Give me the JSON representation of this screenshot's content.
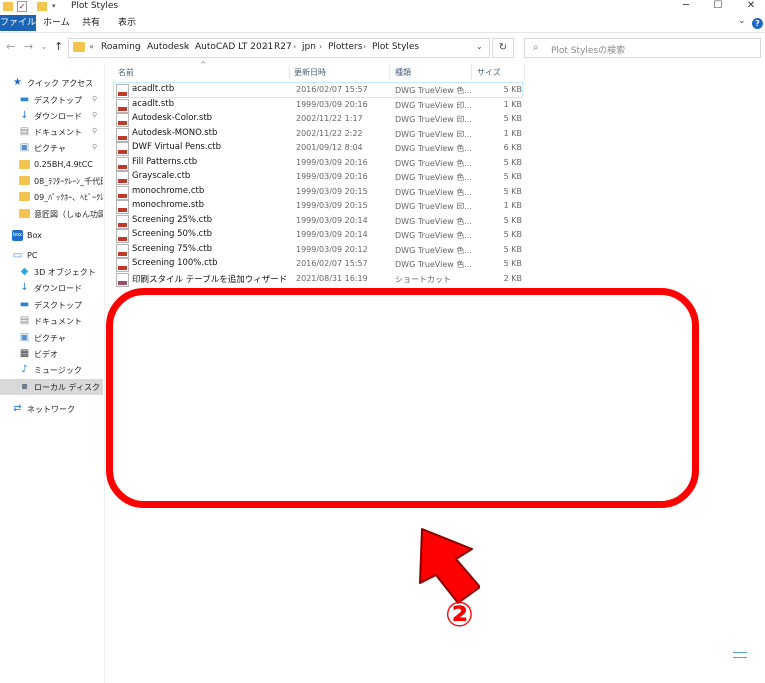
{
  "window": {
    "title": "Plot Styles",
    "minimize": "─",
    "maximize": "☐",
    "close": "✕"
  },
  "ribbon": {
    "tabs": [
      "ファイル",
      "ホーム",
      "共有",
      "表示"
    ],
    "expand": "⌄",
    "help": "?"
  },
  "nav": {
    "back": "←",
    "forward": "→",
    "recent": "⌄",
    "up": "↑",
    "overflow": "«",
    "breadcrumbs": [
      "Roaming",
      "Autodesk",
      "AutoCAD LT 2021",
      "R27",
      "jpn",
      "Plotters",
      "Plot Styles"
    ],
    "dropdown": "⌄",
    "refresh": "↻",
    "search_placeholder": "Plot Stylesの検索"
  },
  "sidebar": {
    "items": [
      {
        "label": "クイック アクセス",
        "icon": "star-icon",
        "pinned": false
      },
      {
        "label": "デスクトップ",
        "icon": "desktop-icon",
        "pinned": true
      },
      {
        "label": "ダウンロード",
        "icon": "download-icon",
        "pinned": true
      },
      {
        "label": "ドキュメント",
        "icon": "documents-icon",
        "pinned": true
      },
      {
        "label": "ピクチャ",
        "icon": "pictures-icon",
        "pinned": true
      },
      {
        "label": "0.25BH,4.9tCC",
        "icon": "folder-icon",
        "pinned": false
      },
      {
        "label": "08_ﾗﾌﾀｰｸﾚｰﾝ_千代田",
        "icon": "folder-icon",
        "pinned": false
      },
      {
        "label": "09_ﾊﾞｯｸﾎｰ、ﾍﾋﾞｰｸﾚｲﾄ",
        "icon": "folder-icon",
        "pinned": false
      },
      {
        "label": "意匠図（しゅん功図ﾅ",
        "icon": "folder-icon",
        "pinned": false
      },
      {
        "label": "Box",
        "icon": "box-icon",
        "pinned": false
      },
      {
        "label": "PC",
        "icon": "pc-icon",
        "pinned": false
      },
      {
        "label": "3D オブジェクト",
        "icon": "3d-objects-icon",
        "pinned": false
      },
      {
        "label": "ダウンロード",
        "icon": "download-icon",
        "pinned": false
      },
      {
        "label": "デスクトップ",
        "icon": "desktop-icon",
        "pinned": false
      },
      {
        "label": "ドキュメント",
        "icon": "documents-icon",
        "pinned": false
      },
      {
        "label": "ピクチャ",
        "icon": "pictures-icon",
        "pinned": false
      },
      {
        "label": "ビデオ",
        "icon": "video-icon",
        "pinned": false
      },
      {
        "label": "ミュージック",
        "icon": "music-icon",
        "pinned": false
      },
      {
        "label": "ローカル ディスク (C:)",
        "icon": "drive-icon",
        "pinned": false,
        "selected": true
      },
      {
        "label": "ネットワーク",
        "icon": "network-icon",
        "pinned": false
      }
    ],
    "pin_glyph": "📌"
  },
  "columns": {
    "name": "名前",
    "date": "更新日時",
    "type": "種類",
    "size": "サイズ"
  },
  "files": [
    {
      "name": "acadlt.ctb",
      "date": "2016/02/07 15:57",
      "type": "DWG TrueView 色...",
      "size": "5 KB",
      "selected": true
    },
    {
      "name": "acadlt.stb",
      "date": "1999/03/09 20:16",
      "type": "DWG TrueView 印...",
      "size": "1 KB"
    },
    {
      "name": "Autodesk-Color.stb",
      "date": "2002/11/22 1:17",
      "type": "DWG TrueView 印...",
      "size": "5 KB"
    },
    {
      "name": "Autodesk-MONO.stb",
      "date": "2002/11/22 2:22",
      "type": "DWG TrueView 印...",
      "size": "1 KB"
    },
    {
      "name": "DWF Virtual Pens.ctb",
      "date": "2001/09/12 8:04",
      "type": "DWG TrueView 色...",
      "size": "6 KB"
    },
    {
      "name": "Fill Patterns.ctb",
      "date": "1999/03/09 20:16",
      "type": "DWG TrueView 色...",
      "size": "5 KB"
    },
    {
      "name": "Grayscale.ctb",
      "date": "1999/03/09 20:16",
      "type": "DWG TrueView 色...",
      "size": "5 KB"
    },
    {
      "name": "monochrome.ctb",
      "date": "1999/03/09 20:15",
      "type": "DWG TrueView 色...",
      "size": "5 KB"
    },
    {
      "name": "monochrome.stb",
      "date": "1999/03/09 20:15",
      "type": "DWG TrueView 印...",
      "size": "1 KB"
    },
    {
      "name": "Screening 25%.ctb",
      "date": "1999/03/09 20:14",
      "type": "DWG TrueView 色...",
      "size": "5 KB"
    },
    {
      "name": "Screening 50%.ctb",
      "date": "1999/03/09 20:14",
      "type": "DWG TrueView 色...",
      "size": "5 KB"
    },
    {
      "name": "Screening 75%.ctb",
      "date": "1999/03/09 20:12",
      "type": "DWG TrueView 色...",
      "size": "5 KB"
    },
    {
      "name": "Screening 100%.ctb",
      "date": "2016/02/07 15:57",
      "type": "DWG TrueView 色...",
      "size": "5 KB"
    },
    {
      "name": "印刷スタイル テーブルを追加ウィザード",
      "date": "2021/08/31 16:19",
      "type": "ショートカット",
      "size": "2 KB",
      "shortcut": true
    }
  ],
  "annotation": {
    "step": "②",
    "color": "#ff0000"
  },
  "colors": {
    "file_tab": "#1a63b5",
    "folder": "#f3c44f",
    "selection": "#cce8ff"
  }
}
